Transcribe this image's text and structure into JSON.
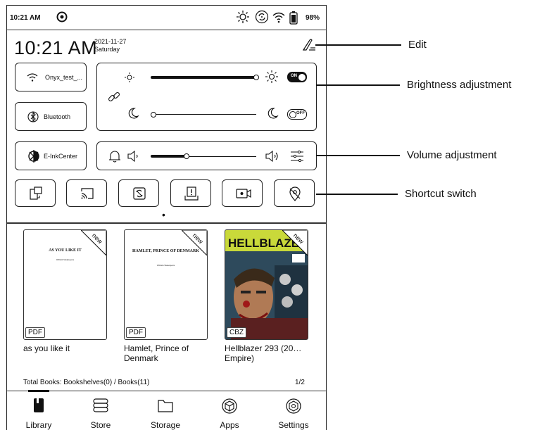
{
  "status_bar": {
    "time": "10:21 AM",
    "battery": "98%"
  },
  "header": {
    "time": "10:21 AM",
    "date": "2021-11-27",
    "day": "Saturday"
  },
  "tiles": {
    "wifi_label": "Onyx_test_...",
    "bluetooth_label": "Bluetooth",
    "einkcenter_label": "E-InkCenter"
  },
  "toggles": {
    "warm_on": "ON",
    "cold_off": "OFF"
  },
  "levels": {
    "brightness_warm": 0.99,
    "brightness_cold": 0.02,
    "volume": 0.33
  },
  "page_indicator": "•",
  "books": [
    {
      "title": "as you like it",
      "format": "PDF",
      "cover_title": "AS YOU LIKE IT",
      "cover_author": "William Shakespeare",
      "new_label": "new"
    },
    {
      "title": "Hamlet, Prince of Denmark",
      "format": "PDF",
      "cover_title": "HAMLET, PRINCE OF DENMARK",
      "cover_author": "William Shakespeare",
      "new_label": "new"
    },
    {
      "title": "Hellblazer 293 (20… Empire)",
      "format": "CBZ",
      "cover_title": "HELLBLAZER",
      "new_label": "new"
    }
  ],
  "library_footer": {
    "summary": "Total Books: Bookshelves(0) / Books(11)",
    "page": "1/2"
  },
  "nav": [
    {
      "label": "Library",
      "icon": "book-icon"
    },
    {
      "label": "Store",
      "icon": "store-icon"
    },
    {
      "label": "Storage",
      "icon": "folder-icon"
    },
    {
      "label": "Apps",
      "icon": "apps-cube-icon"
    },
    {
      "label": "Settings",
      "icon": "settings-icon"
    }
  ],
  "callouts": {
    "edit": "Edit",
    "brightness": "Brightness adjustment",
    "volume": "Volume adjustment",
    "shortcut": "Shortcut switch"
  }
}
